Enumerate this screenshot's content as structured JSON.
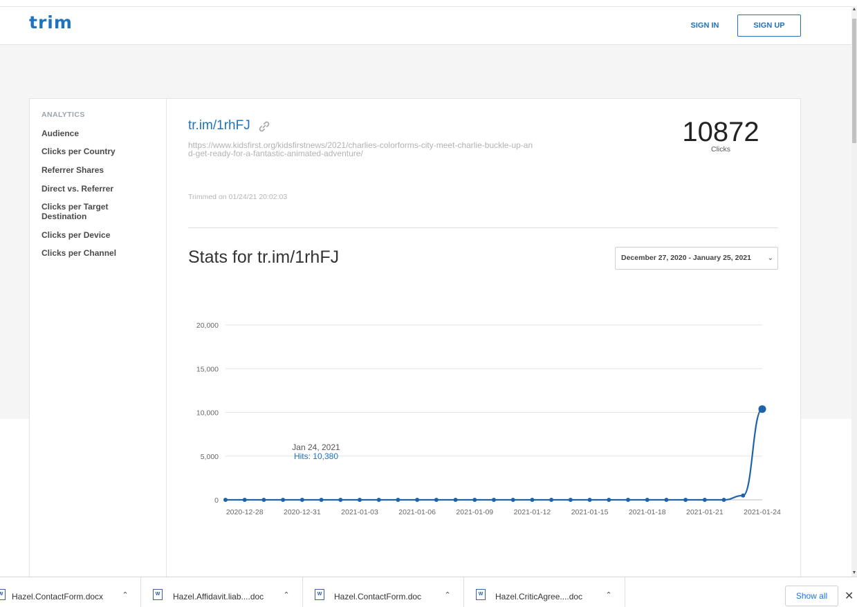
{
  "header": {
    "logo": "trim",
    "sign_in": "SIGN IN",
    "sign_up": "SIGN UP"
  },
  "sidebar": {
    "title": "ANALYTICS",
    "items": [
      {
        "label": "Audience"
      },
      {
        "label": "Clicks per Country"
      },
      {
        "label": "Referrer Shares"
      },
      {
        "label": "Direct vs. Referrer"
      },
      {
        "label": "Clicks per Target Destination"
      },
      {
        "label": "Clicks per Device"
      },
      {
        "label": "Clicks per Channel"
      }
    ]
  },
  "link": {
    "short_url": "tr.im/1rhFJ",
    "long_url": "https://www.kidsfirst.org/kidsfirstnews/2021/charlies-colorforms-city-meet-charlie-buckle-up-and-get-ready-for-a-fantastic-animated-adventure/",
    "trimmed": "Trimmed on 01/24/21 20:02:03",
    "clicks": "10872",
    "clicks_label": "Clicks"
  },
  "stats": {
    "title": "Stats for tr.im/1rhFJ",
    "date_range": "December 27, 2020 - January 25, 2021"
  },
  "tooltip": {
    "date": "Jan 24, 2021",
    "hits": "Hits: 10,380"
  },
  "chart_data": {
    "type": "line",
    "x": [
      "2020-12-27",
      "2020-12-28",
      "2020-12-29",
      "2020-12-30",
      "2020-12-31",
      "2021-01-01",
      "2021-01-02",
      "2021-01-03",
      "2021-01-04",
      "2021-01-05",
      "2021-01-06",
      "2021-01-07",
      "2021-01-08",
      "2021-01-09",
      "2021-01-10",
      "2021-01-11",
      "2021-01-12",
      "2021-01-13",
      "2021-01-14",
      "2021-01-15",
      "2021-01-16",
      "2021-01-17",
      "2021-01-18",
      "2021-01-19",
      "2021-01-20",
      "2021-01-21",
      "2021-01-22",
      "2021-01-23",
      "2021-01-24"
    ],
    "values": [
      0,
      0,
      0,
      0,
      0,
      0,
      0,
      0,
      0,
      0,
      0,
      0,
      0,
      0,
      0,
      0,
      0,
      0,
      0,
      0,
      0,
      0,
      0,
      0,
      0,
      0,
      0,
      490,
      10380
    ],
    "x_tick_labels": [
      "2020-12-28",
      "2020-12-31",
      "2021-01-03",
      "2021-01-06",
      "2021-01-09",
      "2021-01-12",
      "2021-01-15",
      "2021-01-18",
      "2021-01-21",
      "2021-01-24"
    ],
    "y_tick_labels": [
      "0",
      "5,000",
      "10,000",
      "15,000",
      "20,000"
    ],
    "y_ticks": [
      0,
      5000,
      10000,
      15000,
      20000
    ],
    "ylim": [
      0,
      20000
    ],
    "grid": true,
    "color": "#1e63a8",
    "highlight_index": 28
  },
  "downloads": {
    "items": [
      {
        "name": "Hazel.ContactForm.docx"
      },
      {
        "name": "Hazel.Affidavit.liab....doc"
      },
      {
        "name": "Hazel.ContactForm.doc"
      },
      {
        "name": "Hazel.CriticAgree....doc"
      }
    ],
    "show_all": "Show all"
  }
}
